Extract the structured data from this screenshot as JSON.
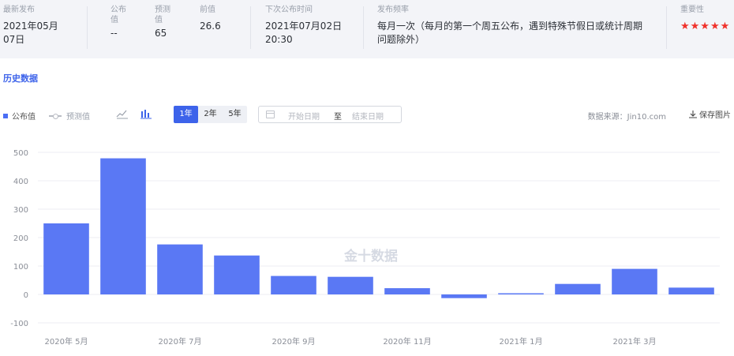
{
  "summary": {
    "latest": {
      "label": "最新发布",
      "value_line1": "2021年05月",
      "value_line2": "07日"
    },
    "published": {
      "label_line1": "公布",
      "label_line2": "值",
      "value": "--"
    },
    "forecast": {
      "label_line1": "预测",
      "label_line2": "值",
      "value": "65"
    },
    "previous": {
      "label": "前值",
      "value": "26.6"
    },
    "next_release": {
      "label": "下次公布时间",
      "value_line1": "2021年07月02日",
      "value_line2": "20:30"
    },
    "frequency": {
      "label": "发布频率",
      "value_line1": "每月一次（每月的第一个周五公布，遇到特殊节假日或统计周期",
      "value_line2": "问题除外）"
    },
    "importance": {
      "label": "重要性",
      "stars": "★★★★★"
    }
  },
  "section_title": "历史数据",
  "toolbar": {
    "legend_published": "公布值",
    "legend_forecast": "预测值",
    "ranges": [
      "1年",
      "2年",
      "5年"
    ],
    "start_placeholder": "开始日期",
    "to_label": "至",
    "end_placeholder": "结束日期",
    "source": "数据来源：Jin10.com",
    "save_label": "保存图片"
  },
  "colors": {
    "accent": "#3d63ea",
    "bar": "#5a78f4",
    "stars": "#f0312b"
  },
  "watermark": "金十数据",
  "chart_data": {
    "type": "bar",
    "series": [
      {
        "name": "公布值",
        "values": [
          250,
          479,
          176,
          137,
          65,
          62,
          22,
          -13,
          4,
          37,
          90,
          24
        ]
      }
    ],
    "x_tick_labels": [
      "2020年 5月",
      "2020年 7月",
      "2020年 9月",
      "2020年 11月",
      "2021年 1月",
      "2021年 3月"
    ],
    "x_tick_positions": [
      0,
      2,
      4,
      6,
      8,
      10
    ],
    "y_ticks": [
      500,
      400,
      300,
      200,
      100,
      0,
      -100
    ],
    "ylim": [
      -100,
      500
    ],
    "grid": true
  }
}
